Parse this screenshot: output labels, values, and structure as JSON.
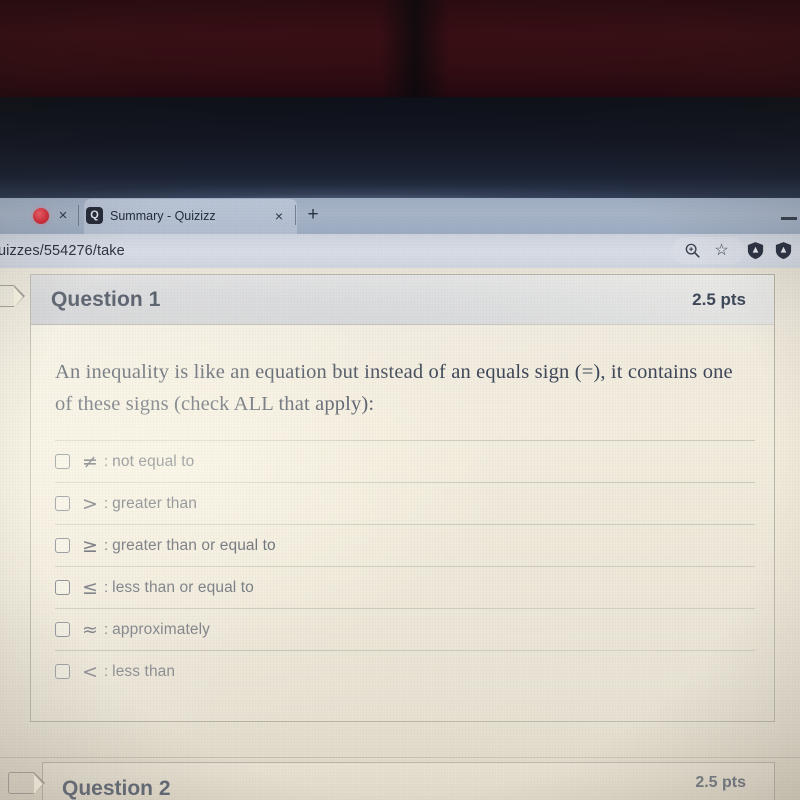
{
  "browser": {
    "recording_tab": {
      "icon": "record-dot-icon",
      "close_label": "×"
    },
    "active_tab": {
      "favicon": "quizizz-q-favicon",
      "favicon_glyph": "Q",
      "title": "Summary - Quizizz",
      "close_label": "×"
    },
    "new_tab_label": "+",
    "minimize_label": "–",
    "url": "uizzes/554276/take",
    "omnibox_icons": [
      "zoom-icon",
      "bookmark-star-icon",
      "shield-extension-icon",
      "shield-extension-icon-2"
    ]
  },
  "quiz": {
    "question1": {
      "title": "Question 1",
      "points": "2.5 pts",
      "prompt": "An inequality is like an equation but instead of an equals sign (=), it contains one of these signs (check ALL that apply):",
      "colon": ":",
      "options": [
        {
          "symbol": "≠",
          "label": "not equal to",
          "checked": false
        },
        {
          "symbol": ">",
          "label": "greater than",
          "checked": false
        },
        {
          "symbol": "≥",
          "label": "greater than or equal to",
          "checked": false
        },
        {
          "symbol": "≤",
          "label": "less than or equal to",
          "checked": false
        },
        {
          "symbol": "≈",
          "label": "approximately",
          "checked": false
        },
        {
          "symbol": "<",
          "label": "less than",
          "checked": false
        }
      ]
    },
    "question2": {
      "title": "Question 2",
      "points": "2.5 pts"
    }
  },
  "colors": {
    "tabstrip": "#9fadc4",
    "urlbar": "#d8dde6",
    "page_paper": "#efe9da",
    "header_band": "#cfd1d6",
    "text_primary": "#3e4758",
    "record_dot": "#d6323f"
  }
}
